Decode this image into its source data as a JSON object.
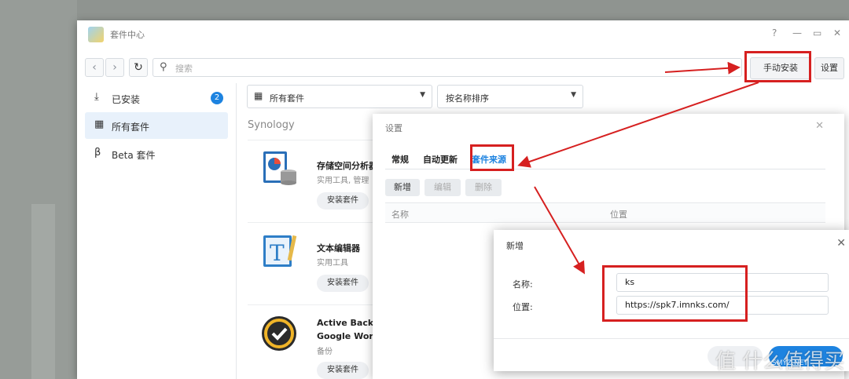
{
  "window": {
    "title": "套件中心",
    "controls": {
      "help": "?",
      "minimize": "—",
      "maximize": "▭",
      "close": "✕"
    }
  },
  "toolbar": {
    "back": "‹",
    "forward": "›",
    "refresh": "↻",
    "search_placeholder": "搜索",
    "manual_install": "手动安装",
    "settings": "设置"
  },
  "sidebar": {
    "items": [
      {
        "label": "已安装",
        "icon": "download-icon",
        "badge": "2"
      },
      {
        "label": "所有套件",
        "icon": "grid-icon"
      },
      {
        "label": "Beta 套件",
        "icon": "beta-icon"
      }
    ]
  },
  "filters": {
    "category": "所有套件",
    "sort": "按名称排序"
  },
  "main": {
    "section_title": "Synology",
    "packages": [
      {
        "name": "存储空间分析器",
        "desc": "实用工具, 管理",
        "button": "安装套件",
        "icon": "storage-analyzer-icon"
      },
      {
        "name": "文本编辑器",
        "desc": "实用工具",
        "button": "安装套件",
        "icon": "text-editor-icon"
      },
      {
        "name": "Active Back",
        "name2": "Google Wor",
        "desc": "备份",
        "button": "安装套件",
        "icon": "active-backup-icon"
      }
    ]
  },
  "settings_dialog": {
    "title": "设置",
    "close": "✕",
    "tabs": [
      "常规",
      "自动更新",
      "套件来源"
    ],
    "buttons": {
      "add": "新增",
      "edit": "编辑",
      "delete": "删除"
    },
    "columns": [
      "名称",
      "位置"
    ]
  },
  "add_dialog": {
    "title": "新增",
    "close": "✕",
    "name_label": "名称:",
    "name_value": "ks",
    "location_label": "位置:",
    "location_value": "https://spk7.imnks.com/"
  },
  "watermark": {
    "text": "值 什么值得买",
    "small": "SMYZ.NET"
  },
  "colors": {
    "accent": "#1d83e0",
    "highlight": "#d62020"
  }
}
